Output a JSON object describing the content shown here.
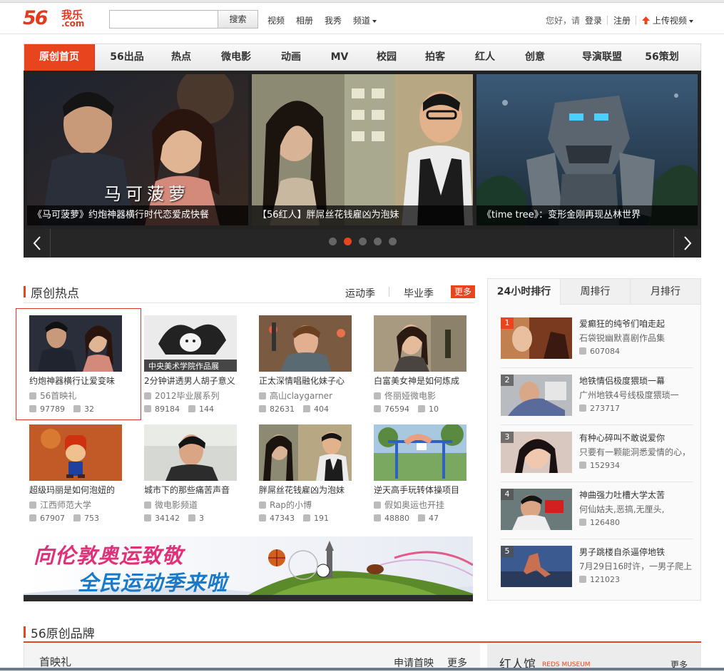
{
  "header": {
    "logo_num": "56",
    "logo_cn": "我乐",
    "logo_en": ".com",
    "search_placeholder": "",
    "search_button": "搜索",
    "links": [
      "视频",
      "相册",
      "我秀",
      "频道"
    ],
    "greeting": "您好，请",
    "login": "登录",
    "register": "注册",
    "upload": "上传视频"
  },
  "nav": [
    "原创首页",
    "56出品",
    "热点",
    "微电影",
    "动画",
    "MV",
    "校园",
    "拍客",
    "红人",
    "创意",
    "导演联盟",
    "56策划"
  ],
  "slider": {
    "slides": [
      {
        "caption": "《马可菠萝》约炮神器横行时代恋爱成快餐",
        "overlay_text": "马可菠萝"
      },
      {
        "caption": "【56红人】胖屌丝花钱雇凶为泡妹"
      },
      {
        "caption": "《time tree》：变形金刚再现丛林世界"
      }
    ],
    "active_dot": 1,
    "dot_count": 5
  },
  "hot": {
    "title": "原创热点",
    "tabs": [
      "运动季",
      "毕业季"
    ],
    "more": "更多",
    "items": [
      {
        "title": "约炮神器横行让爱变味",
        "source": "56首映礼",
        "views": "97789",
        "comments": "32"
      },
      {
        "title": "2分钟讲透男人胡子意义",
        "source": "2012毕业展系列",
        "views": "89184",
        "comments": "144",
        "badge": "中央美术学院作品展"
      },
      {
        "title": "正太深情唱融化妹子心",
        "source": "高山claygarner",
        "views": "82631",
        "comments": "404"
      },
      {
        "title": "白富美女神是如何炼成",
        "source": "佟丽娅微电影",
        "views": "76594",
        "comments": "10"
      },
      {
        "title": "超级玛丽是如何泡妞的",
        "source": "江西师范大学",
        "views": "67907",
        "comments": "753"
      },
      {
        "title": "城市下的那些痛苦声音",
        "source": "微电影频道",
        "views": "34142",
        "comments": "3"
      },
      {
        "title": "胖屌丝花钱雇凶为泡妹",
        "source": "Rap的小博",
        "views": "47343",
        "comments": "191"
      },
      {
        "title": "逆天高手玩转体操项目",
        "source": "假如奥运也开挂",
        "views": "48880",
        "comments": "47"
      }
    ]
  },
  "banner": {
    "line1": "向伦敦奥运致敬",
    "line2": "全民运动季来啦"
  },
  "rank": {
    "tabs": [
      "24小时排行",
      "周排行",
      "月排行"
    ],
    "items": [
      {
        "num": "1",
        "title": "爱癫狂的纯爷们咱走起",
        "desc": "石袋锐幽默喜剧作品集",
        "views": "607084"
      },
      {
        "num": "2",
        "title": "地铁情侣极度猥琐一幕",
        "desc": "广州地铁4号线极度猥琐一",
        "views": "273717"
      },
      {
        "num": "3",
        "title": "有种心碎叫不敢说爱你",
        "desc": "只要有一颗能洞悉爱情的心，",
        "views": "152934"
      },
      {
        "num": "4",
        "title": "神曲强力吐槽大学太苦",
        "desc": "何仙姑夫,恶搞,无厘头,",
        "views": "126480"
      },
      {
        "num": "5",
        "title": "男子跳楼自杀逼停地铁",
        "desc": "7月29日16时许，一男子爬上",
        "views": "121023"
      }
    ]
  },
  "brand": {
    "title": "56原创品牌",
    "sub": "首映礼",
    "apply": "申请首映",
    "more": "更多",
    "right_title": "红人馆",
    "right_en": "REDS MUSEUM",
    "right_more": "更多"
  },
  "colors": {
    "accent": "#e8451e"
  }
}
